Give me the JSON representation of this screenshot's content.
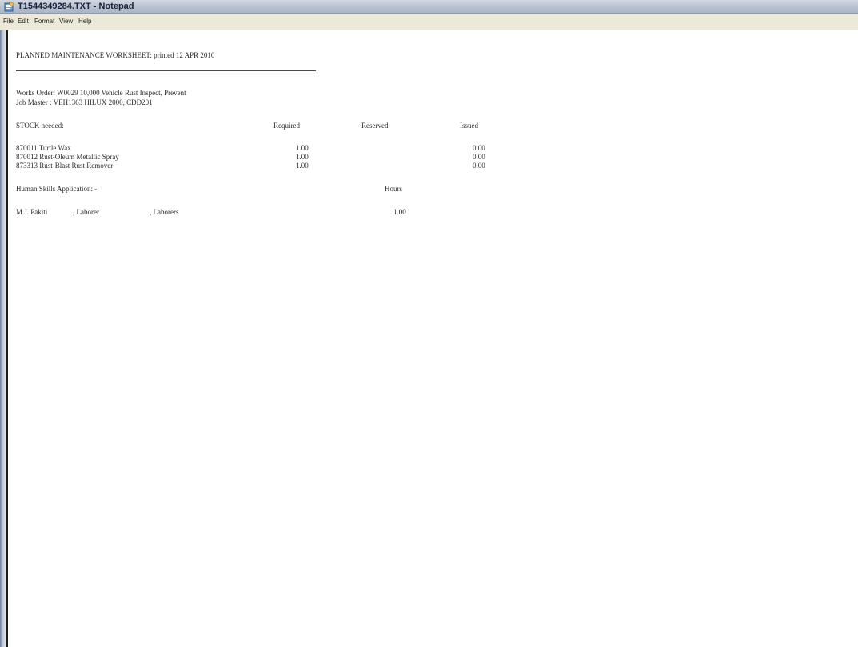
{
  "window": {
    "title": "T1544349284.TXT - Notepad",
    "app_icon": "notepad-icon"
  },
  "menu": {
    "items": [
      "File",
      "Edit",
      "Format",
      "View",
      "Help"
    ]
  },
  "document": {
    "heading": "PLANNED MAINTENANCE WORKSHEET: printed 12 APR 2010",
    "works_order": "Works Order: W0029 10,000 Vehicle Rust Inspect, Prevent",
    "job_master": "Job Master : VEH1363 HILUX 2000, CDD201",
    "stock": {
      "label": "STOCK needed:",
      "columns": [
        "Required",
        "Reserved",
        "Issued"
      ],
      "rows": [
        {
          "item": "870011 Turtle Wax",
          "required": "1.00",
          "reserved": "",
          "issued": "0.00"
        },
        {
          "item": "870012 Rust-Oleum Metallic Spray",
          "required": "1.00",
          "reserved": "",
          "issued": "0.00"
        },
        {
          "item": "873313 Rust-Blast Rust Remover",
          "required": "1.00",
          "reserved": "",
          "issued": "0.00"
        }
      ]
    },
    "skills": {
      "label": "Human Skills Application: -",
      "hours_header": "Hours",
      "rows": [
        {
          "name": "M.J. Pakiti",
          "role": ", Laborer",
          "group": ", Laborers",
          "hours": "1.00"
        }
      ]
    }
  },
  "colors": {
    "titlebar": "#b7c1d1",
    "menubar": "#ece9d8",
    "text": "#2a2a2a"
  }
}
